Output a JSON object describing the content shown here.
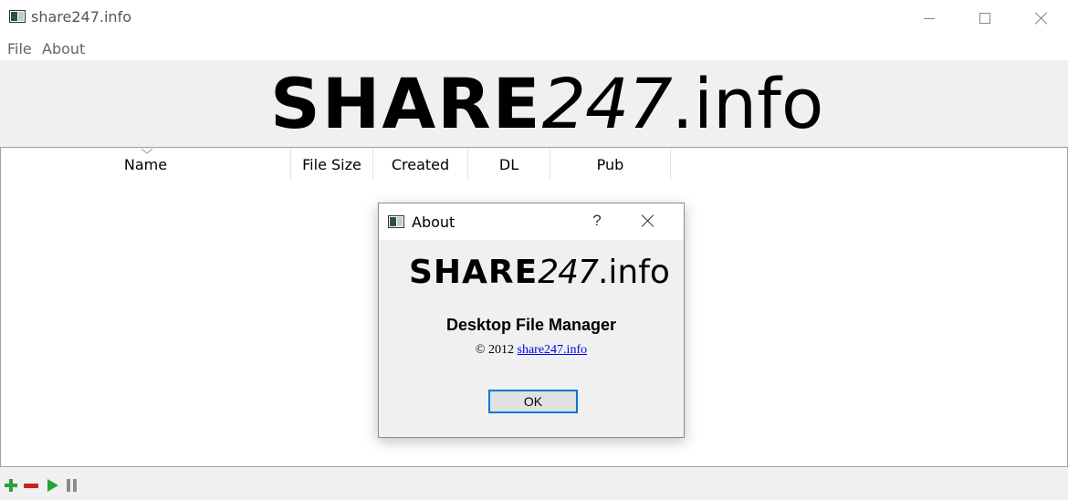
{
  "window": {
    "title": "share247.info"
  },
  "menu": {
    "file": "File",
    "about": "About"
  },
  "banner": {
    "logo_bold": "SHARE",
    "logo_light": "247",
    "logo_suffix": ".info"
  },
  "table": {
    "columns": [
      "Name",
      "File Size",
      "Created",
      "DL",
      "Pub"
    ],
    "sorted_column": "Name"
  },
  "toolbar": {
    "icons": [
      "add-icon",
      "remove-icon",
      "play-icon",
      "pause-icon"
    ]
  },
  "dialog": {
    "title": "About",
    "help": "?",
    "logo_bold": "SHARE",
    "logo_light": "247",
    "logo_suffix": ".info",
    "heading": "Desktop File Manager",
    "copyright": "© 2012",
    "link_text": "share247.info",
    "ok_label": "OK"
  },
  "colors": {
    "add": "#2aa13c",
    "remove": "#cc1f1f",
    "play": "#2aa13c",
    "pause": "#8a8a8a",
    "link": "#0000ee",
    "focus": "#0078d7"
  }
}
